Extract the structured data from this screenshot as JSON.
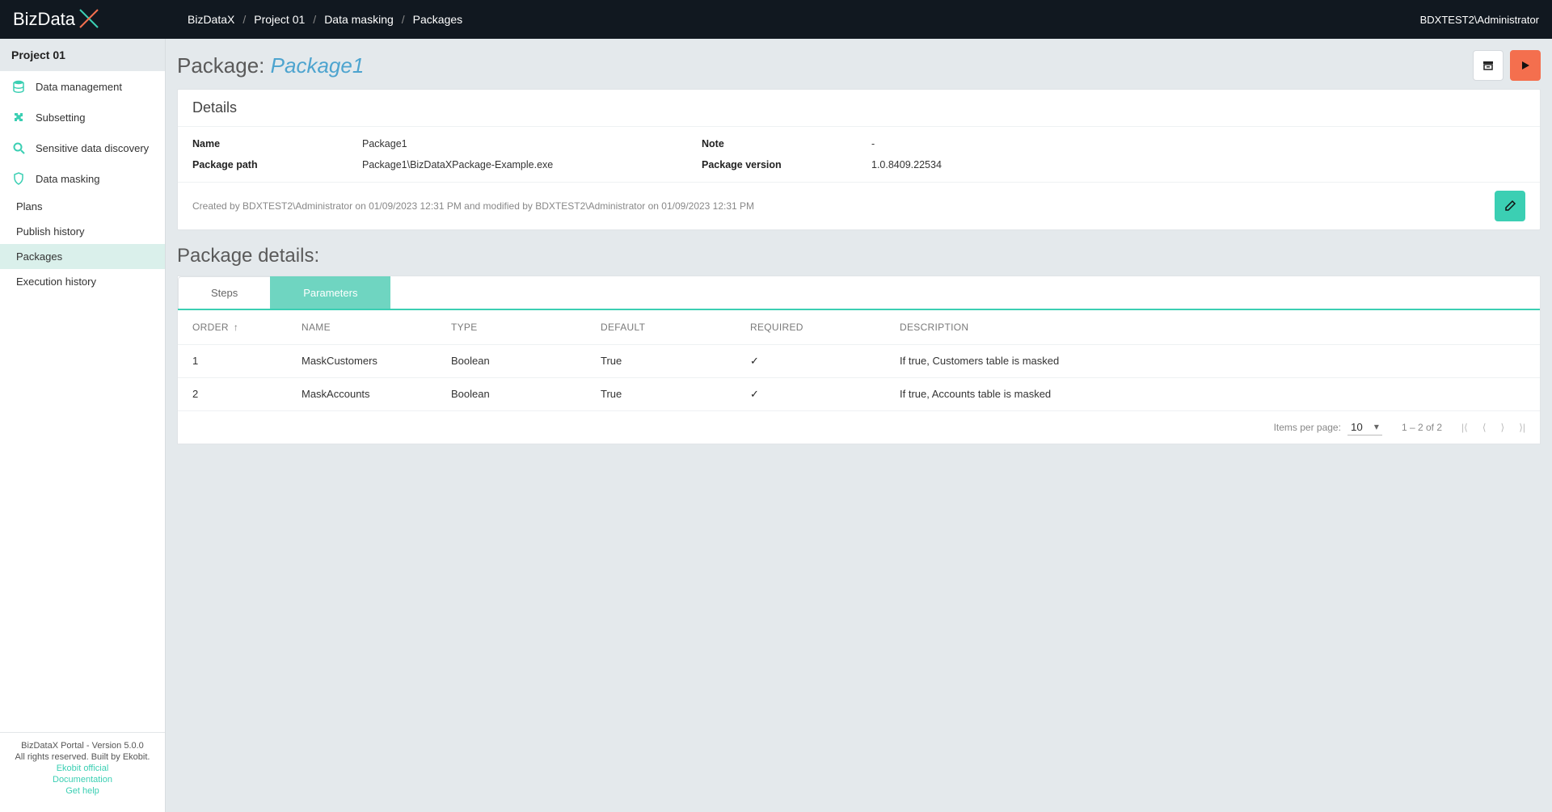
{
  "header": {
    "logo": "BizData",
    "breadcrumb": [
      "BizDataX",
      "Project 01",
      "Data masking",
      "Packages"
    ],
    "user": "BDXTEST2\\Administrator"
  },
  "sidebar": {
    "project": "Project 01",
    "items": [
      {
        "label": "Data management",
        "icon": "database"
      },
      {
        "label": "Subsetting",
        "icon": "puzzle"
      },
      {
        "label": "Sensitive data discovery",
        "icon": "search"
      },
      {
        "label": "Data masking",
        "icon": "shield"
      }
    ],
    "subs": [
      {
        "label": "Plans"
      },
      {
        "label": "Publish history"
      },
      {
        "label": "Packages",
        "active": true
      },
      {
        "label": "Execution history"
      }
    ],
    "footer": {
      "line1": "BizDataX Portal - Version 5.0.0",
      "line2": "All rights reserved. Built by Ekobit.",
      "link1": "Ekobit official",
      "link2": "Documentation",
      "link3": "Get help"
    }
  },
  "page": {
    "title_prefix": "Package: ",
    "title_name": "Package1",
    "details_heading": "Details",
    "details": {
      "name_label": "Name",
      "name_value": "Package1",
      "note_label": "Note",
      "note_value": "-",
      "path_label": "Package path",
      "path_value": "Package1\\BizDataXPackage-Example.exe",
      "version_label": "Package version",
      "version_value": "1.0.8409.22534"
    },
    "audit": "Created by BDXTEST2\\Administrator on 01/09/2023 12:31 PM and modified by BDXTEST2\\Administrator on 01/09/2023 12:31 PM",
    "section_title": "Package details:",
    "tabs": {
      "steps": "Steps",
      "parameters": "Parameters"
    },
    "columns": {
      "order": "ORDER",
      "name": "NAME",
      "type": "TYPE",
      "default": "DEFAULT",
      "required": "REQUIRED",
      "description": "DESCRIPTION"
    },
    "rows": [
      {
        "order": "1",
        "name": "MaskCustomers",
        "type": "Boolean",
        "default": "True",
        "required": true,
        "description": "If true, Customers table is masked"
      },
      {
        "order": "2",
        "name": "MaskAccounts",
        "type": "Boolean",
        "default": "True",
        "required": true,
        "description": "If true, Accounts table is masked"
      }
    ],
    "paginator": {
      "items_per_page_label": "Items per page:",
      "page_size": "10",
      "range": "1 – 2 of 2"
    }
  }
}
